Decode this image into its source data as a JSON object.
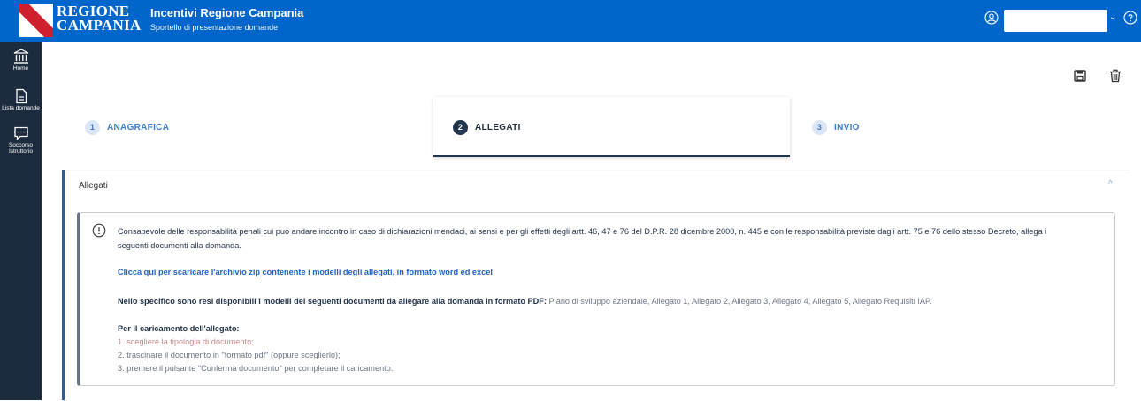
{
  "header": {
    "logo_line1": "REGIONE",
    "logo_line2": "CAMPANIA",
    "title": "Incentivi Regione Campania",
    "subtitle": "Sportello di presentazione domande",
    "user_icon": "user-circle-icon",
    "help_icon": "help-circle-icon",
    "brand_color": "#0066cc"
  },
  "sidebar": {
    "items": [
      {
        "label": "Home",
        "icon": "bank-icon"
      },
      {
        "label": "Lista domande",
        "icon": "document-icon"
      },
      {
        "label": "Soccorso Istruttorio",
        "icon": "chat-icon"
      }
    ]
  },
  "toolbar": {
    "save_icon": "save-icon",
    "delete_icon": "trash-icon"
  },
  "steps": [
    {
      "num": "1",
      "label": "ANAGRAFICA",
      "state": "inactive"
    },
    {
      "num": "2",
      "label": "ALLEGATI",
      "state": "active"
    },
    {
      "num": "3",
      "label": "INVIO",
      "state": "inactive"
    }
  ],
  "section": {
    "title": "Allegati",
    "chevron": "^"
  },
  "info": {
    "line1": "Consapevole delle responsabilità penali cui può andare incontro in caso di dichiarazioni mendaci, ai sensi e per gli effetti degli artt. 46, 47 e 76 del D.P.R. 28 dicembre 2000, n. 445 e con le responsabilità previste dagli artt. 75 e 76 dello stesso Decreto, allega i",
    "line2": "seguenti documenti alla domanda.",
    "link": "Clicca qui per scaricare l'archivio zip contenente i modelli degli allegati, in formato word ed excel",
    "detail_bold": "Nello specifico sono resi disponibili i modelli dei seguenti documenti da allegare alla domanda in formato PDF:",
    "detail_list": " Piano di sviluppo aziendale, Allegato 1, Allegato 2, Allegato 3, Allegato 4, Allegato 5, Allegato Requisiti IAP.",
    "upload_title": "Per il caricamento dell'allegato:",
    "step1": "1. scegliere la tipologia di documento;",
    "step2": "2. trascinare il documento in \"formato pdf\" (oppure sceglierlo);",
    "step3": "3. premere il pulsante \"Conferma documento\" per completare il caricamento."
  }
}
